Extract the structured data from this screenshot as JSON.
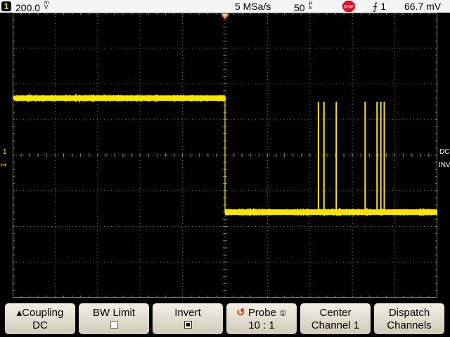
{
  "status": {
    "channel_number": "1",
    "channel_scale_value": "200.0",
    "channel_scale_unit_top": "m",
    "channel_scale_unit_bottom": "V",
    "trigger_icon": "trigger-marker-icon",
    "sample_rate": "5 MSa/s",
    "timebase_value": "50",
    "timebase_unit_top": "µ",
    "timebase_unit_bottom": "s",
    "run_state": "STOP",
    "trigger_source": "1",
    "trigger_level": "66.7 mV"
  },
  "colors": {
    "trace": "#ffe600",
    "grid": "#7f7f7f",
    "status_bg": "#f4f4f4",
    "stop": "#e0102a",
    "accent": "#c83000"
  },
  "side": {
    "channel_marker": "1",
    "coupling_indicator": "DC",
    "inverted_indicator": "INV"
  },
  "softkeys": [
    {
      "name": "coupling",
      "line1": "Coupling",
      "line2": "DC"
    },
    {
      "name": "bw-limit",
      "line1": "BW Limit",
      "line2": ""
    },
    {
      "name": "invert",
      "line1": "Invert",
      "line2": ""
    },
    {
      "name": "probe",
      "line1": "Probe",
      "line2": "10 : 1"
    },
    {
      "name": "center",
      "line1": "Center",
      "line2": "Channel 1"
    },
    {
      "name": "dispatch",
      "line1": "Dispatch",
      "line2": "Channels"
    }
  ],
  "chart_data": {
    "type": "line",
    "x_divisions": 10,
    "y_divisions": 8,
    "x_unit": "div",
    "y_unit": "div",
    "series": [
      {
        "x": [
          0,
          5.0,
          5.0,
          10
        ],
        "y": [
          1.6,
          1.6,
          -1.6,
          -1.6
        ]
      }
    ],
    "spikes_x": [
      7.2,
      7.33,
      7.62,
      8.3,
      8.58,
      8.67,
      8.75
    ],
    "spike_top_y": 1.5,
    "noise_band": 0.15
  }
}
